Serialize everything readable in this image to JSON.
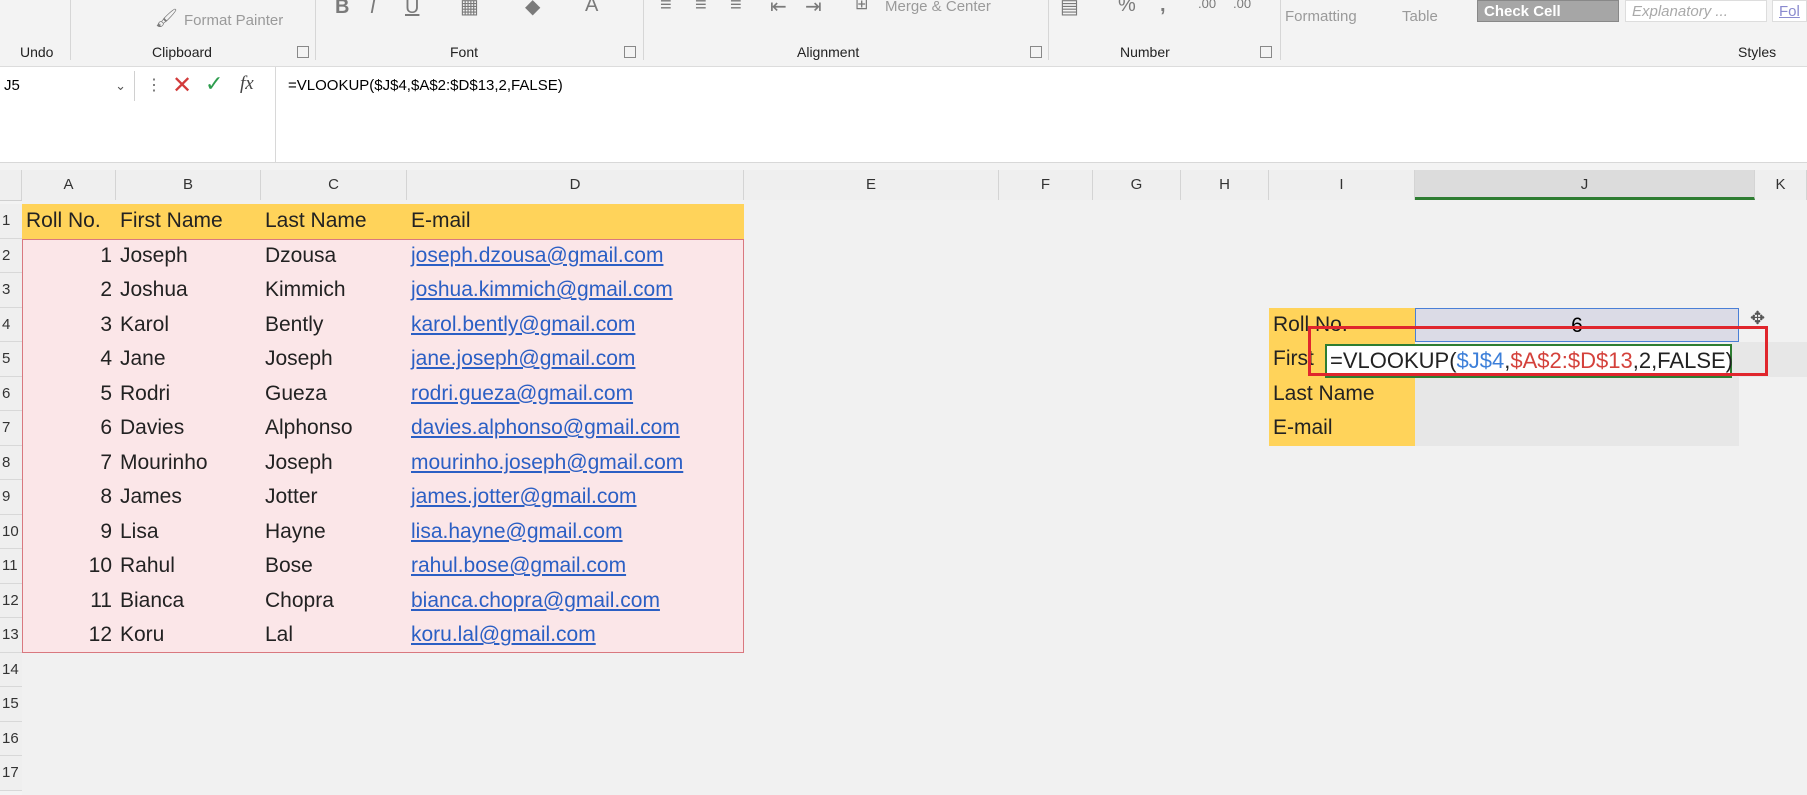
{
  "ribbon": {
    "groups": {
      "undo": "Undo",
      "clipboard": "Clipboard",
      "font": "Font",
      "alignment": "Alignment",
      "number": "Number",
      "styles": "Styles"
    },
    "format_painter": "Format Painter",
    "merge_center": "Merge & Center",
    "conditional_formatting": "Formatting",
    "format_as_table": "Table",
    "check_cell": "Check Cell",
    "explanatory": "Explanatory ...",
    "follow": "Fol"
  },
  "formula_bar": {
    "name_box": "J5",
    "formula": "=VLOOKUP($J$4,$A$2:$D$13,2,FALSE)"
  },
  "columns": [
    "A",
    "B",
    "C",
    "D",
    "E",
    "F",
    "G",
    "H",
    "I",
    "J",
    "K"
  ],
  "rows": [
    "1",
    "2",
    "3",
    "4",
    "5",
    "6",
    "7",
    "8",
    "9",
    "10",
    "11",
    "12",
    "13",
    "14",
    "15",
    "16",
    "17"
  ],
  "table": {
    "headers": [
      "Roll No.",
      "First Name",
      "Last Name",
      "E-mail"
    ],
    "rows": [
      [
        "1",
        "Joseph",
        "Dzousa",
        "joseph.dzousa@gmail.com"
      ],
      [
        "2",
        "Joshua",
        "Kimmich",
        "joshua.kimmich@gmail.com"
      ],
      [
        "3",
        "Karol",
        "Bently",
        "karol.bently@gmail.com"
      ],
      [
        "4",
        "Jane",
        "Joseph",
        "jane.joseph@gmail.com"
      ],
      [
        "5",
        "Rodri",
        "Gueza",
        "rodri.gueza@gmail.com"
      ],
      [
        "6",
        "Davies",
        "Alphonso",
        "davies.alphonso@gmail.com"
      ],
      [
        "7",
        "Mourinho",
        "Joseph",
        "mourinho.joseph@gmail.com"
      ],
      [
        "8",
        "James",
        "Jotter",
        "james.jotter@gmail.com"
      ],
      [
        "9",
        "Lisa",
        "Hayne",
        "lisa.hayne@gmail.com"
      ],
      [
        "10",
        "Rahul",
        "Bose",
        "rahul.bose@gmail.com"
      ],
      [
        "11",
        "Bianca",
        "Chopra",
        "bianca.chopra@gmail.com"
      ],
      [
        "12",
        "Koru",
        "Lal",
        "koru.lal@gmail.com"
      ]
    ]
  },
  "lookup": {
    "labels": [
      "Roll No.",
      "First",
      "Last Name",
      "E-mail"
    ],
    "roll_value": "6",
    "formula_parts": {
      "prefix": "=VLOOKUP(",
      "ref1": "$J$4",
      "comma1": ",",
      "ref2": "$A$2:$D$13",
      "suffix": ",2,FALSE)"
    }
  }
}
